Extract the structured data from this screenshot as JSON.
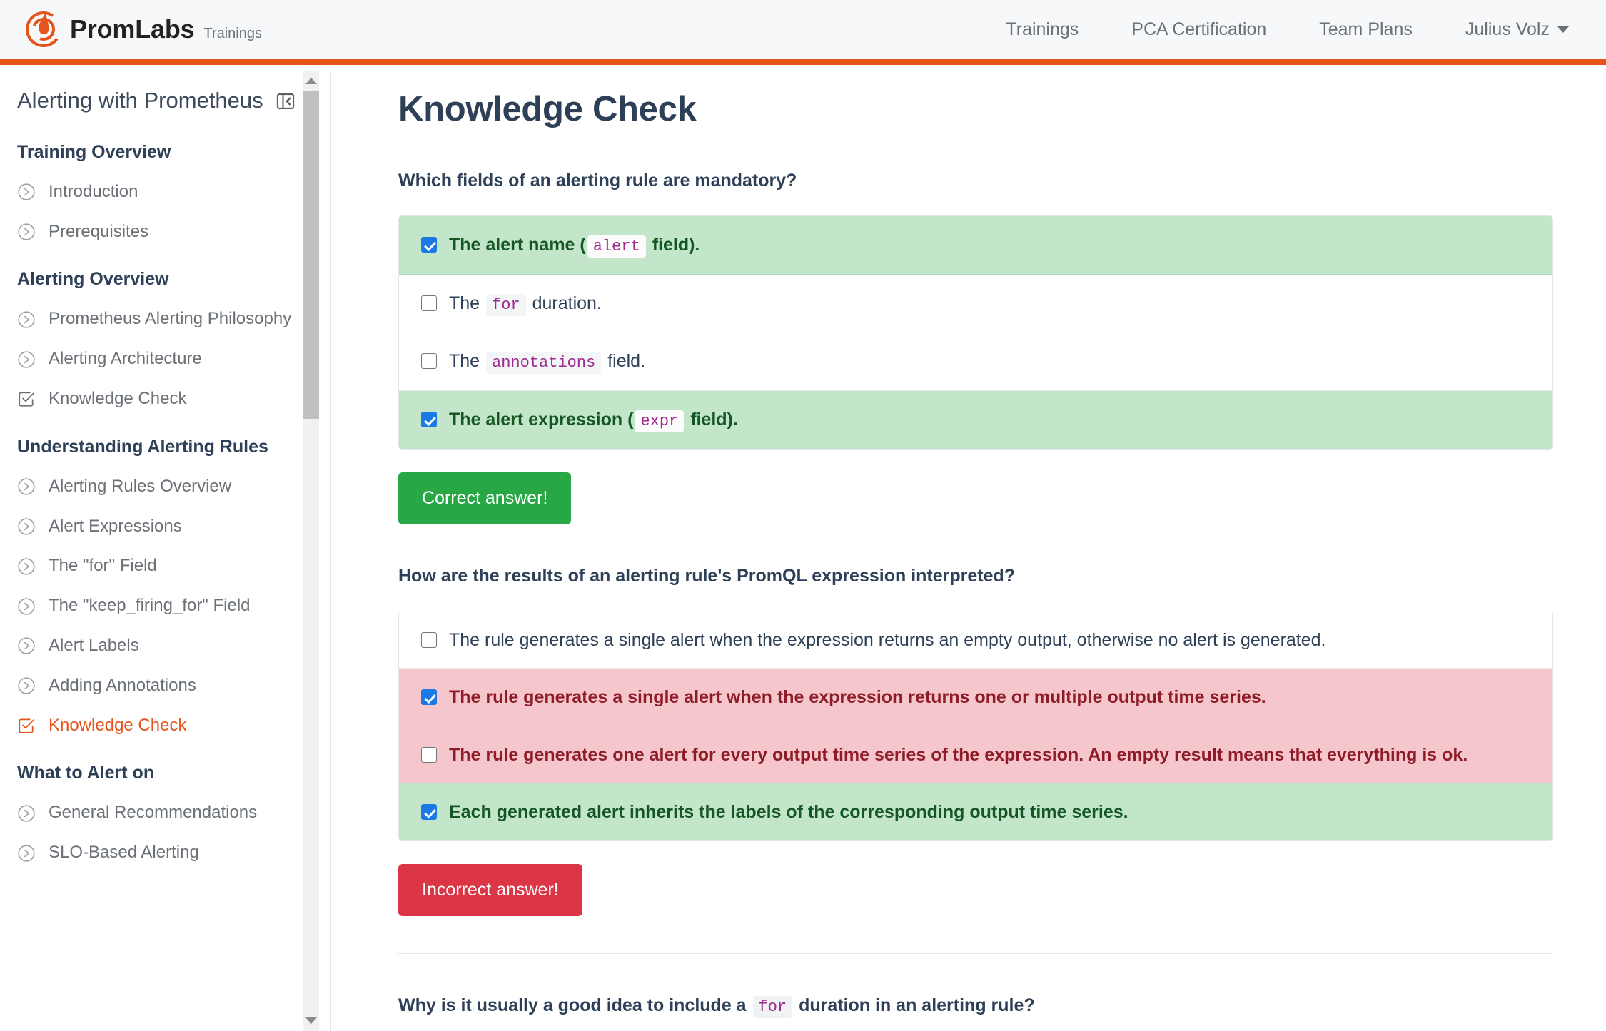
{
  "header": {
    "brand_name": "PromLabs",
    "brand_sub": "Trainings",
    "logo_icon": "promlabs-logo-icon",
    "nav_links": [
      {
        "label": "Trainings"
      },
      {
        "label": "PCA Certification"
      },
      {
        "label": "Team Plans"
      }
    ],
    "user": {
      "name": "Julius Volz",
      "caret_icon": "chevron-down-icon"
    }
  },
  "sidebar": {
    "title": "Alerting with Prometheus",
    "collapse_icon": "panel-collapse-icon",
    "scroll_up_icon": "scroll-up-arrow-icon",
    "scroll_down_icon": "scroll-down-arrow-icon",
    "sections": [
      {
        "heading": "Training Overview",
        "items": [
          {
            "label": "Introduction",
            "icon": "play-circle-icon",
            "active": false
          },
          {
            "label": "Prerequisites",
            "icon": "play-circle-icon",
            "active": false
          }
        ]
      },
      {
        "heading": "Alerting Overview",
        "items": [
          {
            "label": "Prometheus Alerting Philosophy",
            "icon": "play-circle-icon",
            "active": false
          },
          {
            "label": "Alerting Architecture",
            "icon": "play-circle-icon",
            "active": false
          },
          {
            "label": "Knowledge Check",
            "icon": "check-square-icon",
            "active": false
          }
        ]
      },
      {
        "heading": "Understanding Alerting Rules",
        "items": [
          {
            "label": "Alerting Rules Overview",
            "icon": "play-circle-icon",
            "active": false
          },
          {
            "label": "Alert Expressions",
            "icon": "play-circle-icon",
            "active": false
          },
          {
            "label": "The \"for\" Field",
            "icon": "play-circle-icon",
            "active": false
          },
          {
            "label": "The \"keep_firing_for\" Field",
            "icon": "play-circle-icon",
            "active": false
          },
          {
            "label": "Alert Labels",
            "icon": "play-circle-icon",
            "active": false
          },
          {
            "label": "Adding Annotations",
            "icon": "play-circle-icon",
            "active": false
          },
          {
            "label": "Knowledge Check",
            "icon": "check-square-icon",
            "active": true
          }
        ]
      },
      {
        "heading": "What to Alert on",
        "items": [
          {
            "label": "General Recommendations",
            "icon": "play-circle-icon",
            "active": false
          },
          {
            "label": "SLO-Based Alerting",
            "icon": "play-circle-icon",
            "active": false
          }
        ]
      }
    ]
  },
  "main": {
    "page_title": "Knowledge Check",
    "questions": [
      {
        "id": "q1",
        "prompt_parts": [
          {
            "type": "text",
            "value": "Which fields of an alerting rule are mandatory?"
          }
        ],
        "answers": [
          {
            "checked": true,
            "state": "correct",
            "parts": [
              {
                "type": "text",
                "value": "The alert name ("
              },
              {
                "type": "code",
                "value": "alert"
              },
              {
                "type": "text",
                "value": " field)."
              }
            ]
          },
          {
            "checked": false,
            "state": "neutral",
            "parts": [
              {
                "type": "text",
                "value": "The "
              },
              {
                "type": "code",
                "value": "for"
              },
              {
                "type": "text",
                "value": " duration."
              }
            ]
          },
          {
            "checked": false,
            "state": "neutral",
            "parts": [
              {
                "type": "text",
                "value": "The "
              },
              {
                "type": "code",
                "value": "annotations"
              },
              {
                "type": "text",
                "value": " field."
              }
            ]
          },
          {
            "checked": true,
            "state": "correct",
            "parts": [
              {
                "type": "text",
                "value": "The alert expression ("
              },
              {
                "type": "code",
                "value": "expr"
              },
              {
                "type": "text",
                "value": " field)."
              }
            ]
          }
        ],
        "verdict": {
          "label": "Correct answer!",
          "state": "ok"
        },
        "divider_after": false
      },
      {
        "id": "q2",
        "prompt_parts": [
          {
            "type": "text",
            "value": "How are the results of an alerting rule's PromQL expression interpreted?"
          }
        ],
        "answers": [
          {
            "checked": false,
            "state": "neutral",
            "parts": [
              {
                "type": "text",
                "value": "The rule generates a single alert when the expression returns an empty output, otherwise no alert is generated."
              }
            ]
          },
          {
            "checked": true,
            "state": "wrong",
            "parts": [
              {
                "type": "text",
                "value": "The rule generates a single alert when the expression returns one or multiple output time series."
              }
            ]
          },
          {
            "checked": false,
            "state": "wrong",
            "parts": [
              {
                "type": "text",
                "value": "The rule generates one alert for every output time series of the expression. An empty result means that everything is ok."
              }
            ]
          },
          {
            "checked": true,
            "state": "correct",
            "parts": [
              {
                "type": "text",
                "value": "Each generated alert inherits the labels of the corresponding output time series."
              }
            ]
          }
        ],
        "verdict": {
          "label": "Incorrect answer!",
          "state": "bad"
        },
        "divider_after": true
      },
      {
        "id": "q3",
        "prompt_parts": [
          {
            "type": "text",
            "value": "Why is it usually a good idea to include a "
          },
          {
            "type": "code",
            "value": "for"
          },
          {
            "type": "text",
            "value": " duration in an alerting rule?"
          }
        ],
        "answers": [],
        "verdict": null,
        "divider_after": false
      }
    ]
  },
  "colors": {
    "brand_orange": "#e4541b",
    "heading_navy": "#2e4057",
    "correct_bg": "#c3e6cb",
    "correct_text": "#155724",
    "wrong_bg": "#f5c6cb",
    "wrong_text": "#8e1c28",
    "checkbox_blue": "#1b79e6",
    "verdict_ok": "#28a745",
    "verdict_bad": "#dc3545",
    "code_purple": "#9c2a8f"
  }
}
